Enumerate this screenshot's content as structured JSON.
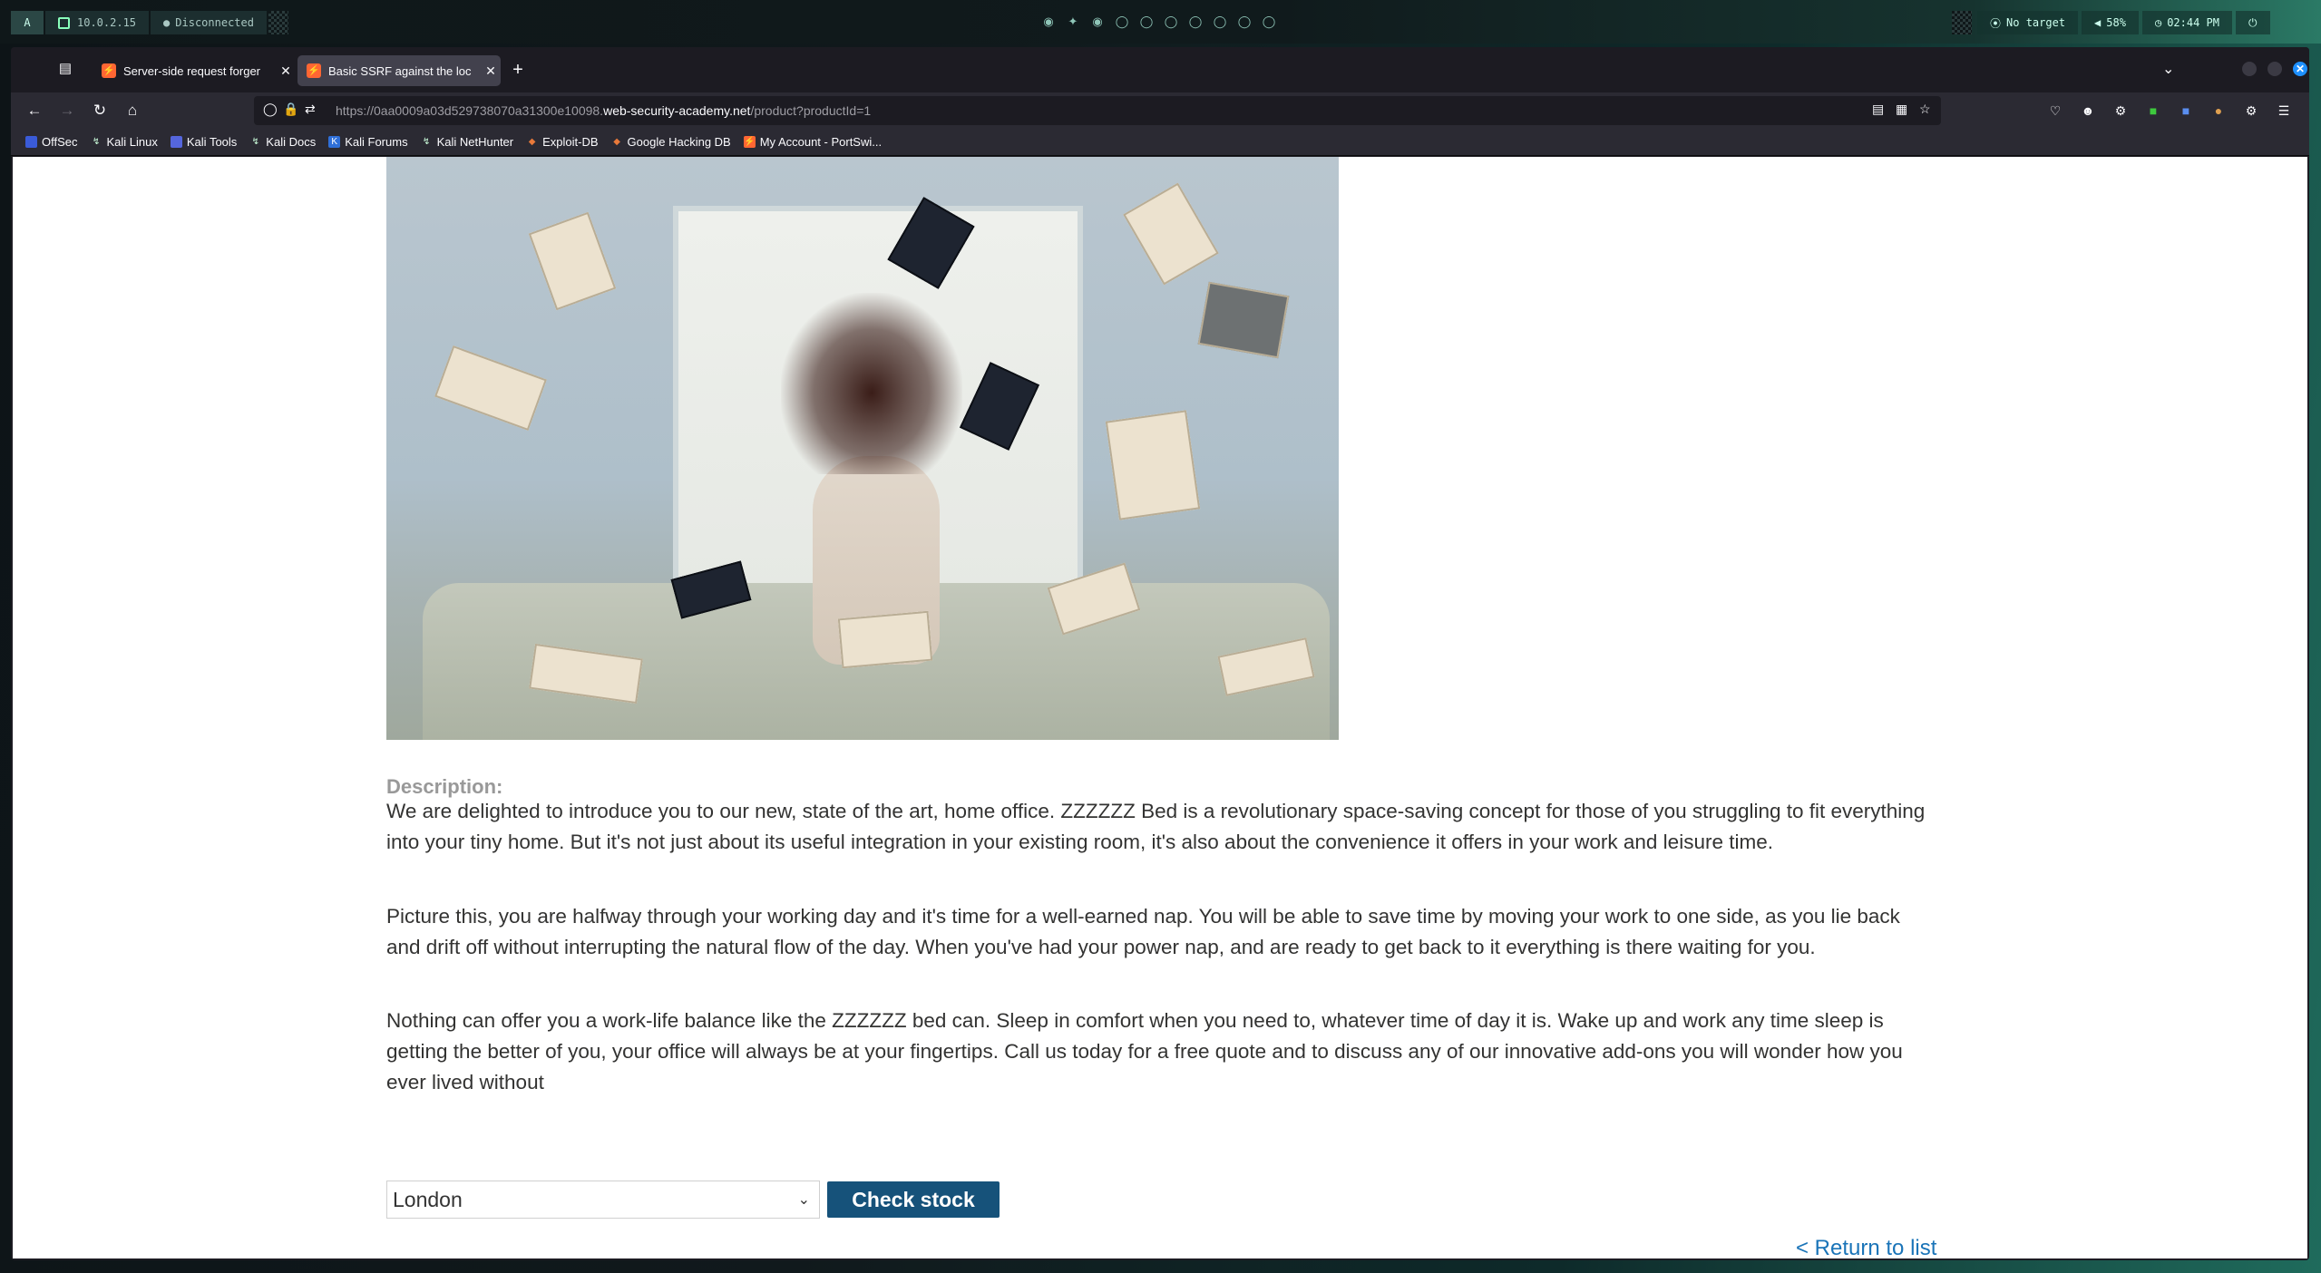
{
  "panel": {
    "menu_glyph": "A",
    "ip": "10.0.2.15",
    "vpn_status": "Disconnected",
    "target": "No target",
    "volume": "58%",
    "clock": "02:44 PM"
  },
  "browser": {
    "tabs": [
      {
        "title": "Server-side request forger",
        "active": false
      },
      {
        "title": "Basic SSRF against the loc",
        "active": true
      }
    ],
    "url_prefix": "https://0aa0009a03d529738070a31300e10098.",
    "url_domain": "web-security-academy.net",
    "url_path": "/product?productId=1",
    "bookmarks": [
      {
        "label": "OffSec",
        "icon": "offsec-icon"
      },
      {
        "label": "Kali Linux",
        "icon": "kali-dragon-icon"
      },
      {
        "label": "Kali Tools",
        "icon": "kali-tools-icon"
      },
      {
        "label": "Kali Docs",
        "icon": "kali-dragon-icon"
      },
      {
        "label": "Kali Forums",
        "icon": "kali-forums-icon"
      },
      {
        "label": "Kali NetHunter",
        "icon": "kali-dragon-icon"
      },
      {
        "label": "Exploit-DB",
        "icon": "exploit-db-icon"
      },
      {
        "label": "Google Hacking DB",
        "icon": "exploit-db-icon"
      },
      {
        "label": "My Account - PortSwi...",
        "icon": "portswigger-icon"
      }
    ]
  },
  "page": {
    "description_label": "Description:",
    "paragraphs": [
      "We are delighted to introduce you to our new, state of the art, home office. ZZZZZZ Bed is a revolutionary space-saving concept for those of you struggling to fit everything into your tiny home. But it's not just about its useful integration in your existing room, it's also about the convenience it offers in your work and leisure time.",
      "Picture this, you are halfway through your working day and it's time for a well-earned nap. You will be able to save time by moving your work to one side, as you lie back and drift off without interrupting the natural flow of the day. When you've had your power nap, and are ready to get back to it everything is there waiting for you.",
      "Nothing can offer you a work-life balance like the ZZZZZZ bed can. Sleep in comfort when you need to, whatever time of day it is. Wake up and work any time sleep is getting the better of you, your office will always be at your fingertips. Call us today for a free quote and to discuss any of our innovative add-ons you will wonder how you ever lived without"
    ],
    "stock_select_value": "London",
    "check_stock_label": "Check stock",
    "return_link": "< Return to list"
  },
  "colors": {
    "accent_button": "#16527a",
    "link": "#1a74b8",
    "favicon": "#ff6633"
  }
}
